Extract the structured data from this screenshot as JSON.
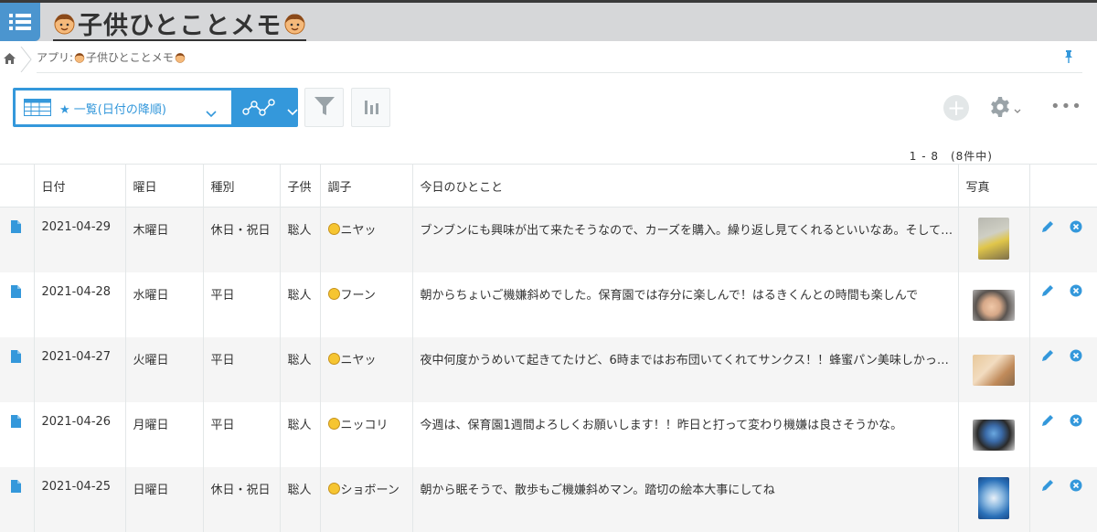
{
  "app": {
    "title": "子供ひとことメモ"
  },
  "breadcrumb": {
    "label": "アプリ: ",
    "app_name": "子供ひとことメモ"
  },
  "toolbar": {
    "view_name": "★ 一覧(日付の降順)",
    "count": "1 - 8　(8件中)"
  },
  "table": {
    "headers": [
      "日付",
      "曜日",
      "種別",
      "子供",
      "調子",
      "今日のひとこと",
      "写真"
    ],
    "rows": [
      {
        "date": "2021-04-29",
        "weekday": "木曜日",
        "type": "休日・祝日",
        "child": "聡人",
        "mood": "ニヤッ",
        "note": "ブンブンにも興味が出て来たそうなので、カーズを購入。繰り返し見てくれるといいなあ。そして…"
      },
      {
        "date": "2021-04-28",
        "weekday": "水曜日",
        "type": "平日",
        "child": "聡人",
        "mood": "フーン",
        "note": "朝からちょいご機嫌斜めでした。保育園では存分に楽しんで！はるきくんとの時間も楽しんで"
      },
      {
        "date": "2021-04-27",
        "weekday": "火曜日",
        "type": "平日",
        "child": "聡人",
        "mood": "ニヤッ",
        "note": "夜中何度かうめいて起きてたけど、6時まではお布団いてくれてサンクス！！蜂蜜パン美味しかっ…"
      },
      {
        "date": "2021-04-26",
        "weekday": "月曜日",
        "type": "平日",
        "child": "聡人",
        "mood": "ニッコリ",
        "note": "今週は、保育園1週間よろしくお願いします！！昨日と打って変わり機嫌は良さそうかな。"
      },
      {
        "date": "2021-04-25",
        "weekday": "日曜日",
        "type": "休日・祝日",
        "child": "聡人",
        "mood": "ショボーン",
        "note": "朝から眠そうで、散歩もご機嫌斜めマン。踏切の絵本大事にしてね"
      }
    ]
  },
  "colors": {
    "accent": "#3498db",
    "header_bg": "#d6d7d9",
    "action_blue": "#3498db"
  }
}
